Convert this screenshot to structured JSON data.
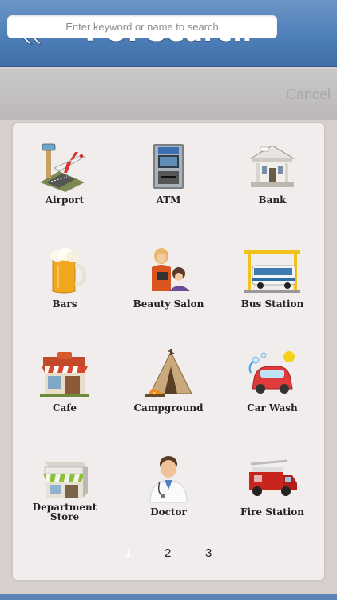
{
  "header": {
    "title": "POI Search",
    "back_icon": "double-chevron-left-icon",
    "color": "#4f7fb9"
  },
  "search": {
    "placeholder": "Enter keyword or name to search",
    "value": "",
    "cancel_label": "Cancel"
  },
  "grid": {
    "items": [
      {
        "label": "Airport",
        "icon": "airport-icon"
      },
      {
        "label": "ATM",
        "icon": "atm-icon"
      },
      {
        "label": "Bank",
        "icon": "bank-icon"
      },
      {
        "label": "Bars",
        "icon": "beer-mug-icon"
      },
      {
        "label": "Beauty Salon",
        "icon": "hairdresser-icon"
      },
      {
        "label": "Bus Station",
        "icon": "bus-icon"
      },
      {
        "label": "Cafe",
        "icon": "cafe-storefront-icon"
      },
      {
        "label": "Campground",
        "icon": "tent-campfire-icon"
      },
      {
        "label": "Car Wash",
        "icon": "car-wash-icon"
      },
      {
        "label": "Department\nStore",
        "icon": "storefront-icon"
      },
      {
        "label": "Doctor",
        "icon": "doctor-icon"
      },
      {
        "label": "Fire Station",
        "icon": "fire-truck-icon"
      }
    ]
  },
  "pagination": {
    "pages": [
      "1",
      "2",
      "3"
    ],
    "current": "1"
  }
}
